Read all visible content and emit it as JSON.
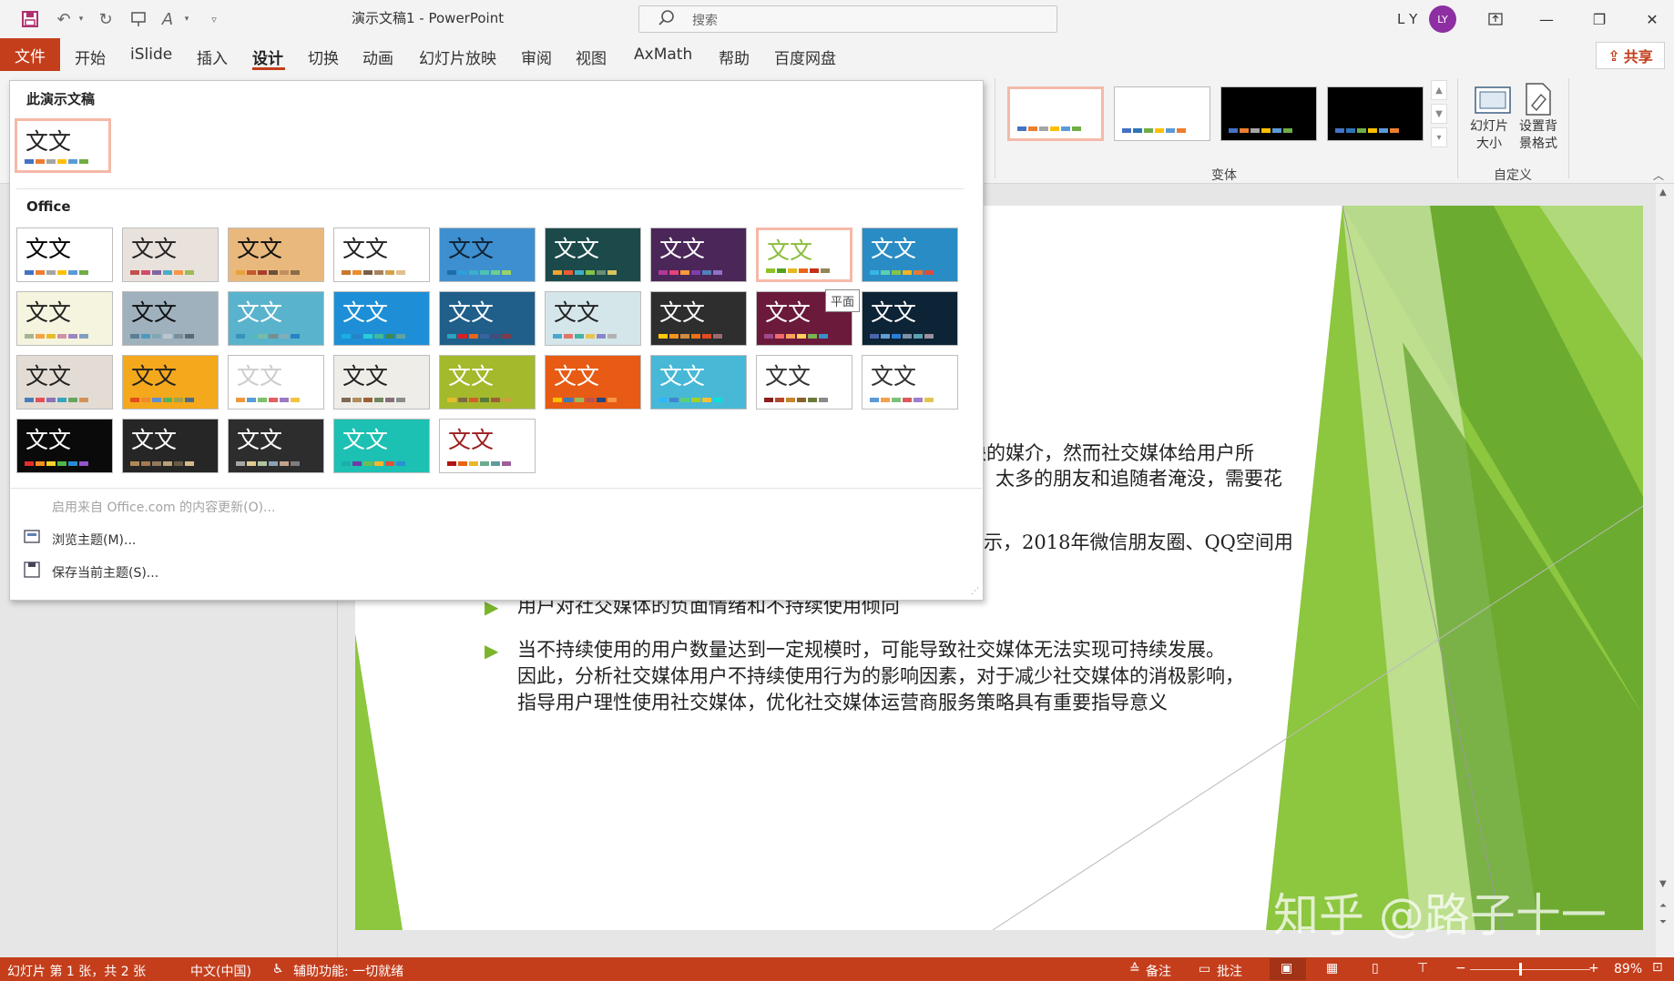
{
  "window": {
    "title": "演示文稿1  -  PowerPoint",
    "search_placeholder": "搜索",
    "user_name": "L Y",
    "user_initials": "LY"
  },
  "ribbon": {
    "tabs": [
      "文件",
      "开始",
      "iSlide",
      "插入",
      "设计",
      "切换",
      "动画",
      "幻灯片放映",
      "审阅",
      "视图",
      "AxMath",
      "帮助",
      "百度网盘"
    ],
    "active_tab": "设计",
    "share_label": "共享",
    "variants_group_label": "变体",
    "customize_group_label": "自定义",
    "slide_size_label": "幻灯片大小",
    "format_bg_label": "设置背景格式",
    "variant_swatches": [
      {
        "bg": "#ffffff",
        "colors": [
          "#4472c4",
          "#ed7d31",
          "#a5a5a5",
          "#ffc000",
          "#5b9bd5",
          "#70ad47"
        ]
      },
      {
        "bg": "#ffffff",
        "colors": [
          "#4472c4",
          "#2e75b6",
          "#70ad47",
          "#ffc000",
          "#5b9bd5",
          "#ed7d31"
        ]
      },
      {
        "bg": "#000000",
        "colors": [
          "#4472c4",
          "#ed7d31",
          "#a5a5a5",
          "#ffc000",
          "#5b9bd5",
          "#70ad47"
        ]
      },
      {
        "bg": "#000000",
        "colors": [
          "#4472c4",
          "#2e75b6",
          "#70ad47",
          "#ffc000",
          "#5b9bd5",
          "#ed7d31"
        ]
      }
    ]
  },
  "themes_dropdown": {
    "this_presentation_label": "此演示文稿",
    "office_label": "Office",
    "theme_sample_text": "文文",
    "tooltip": "平面",
    "menu_enable_updates": "启用来自 Office.com 的内容更新(O)...",
    "menu_browse": "浏览主题(M)...",
    "menu_save": "保存当前主题(S)..."
  },
  "slide": {
    "text_1a": "缺的媒介，然而社交媒体给用户所",
    "text_1b": "太多的朋友和追随者淹没，需要花",
    "text_2": "示，2018年微信朋友圈、QQ空间用",
    "bullet_1": "用户对社交媒体的负面情绪和不持续使用倾向",
    "bullet_2_l1": "当不持续使用的用户数量达到一定规模时，可能导致社交媒体无法实现可持续发展。",
    "bullet_2_l2": "因此，分析社交媒体用户不持续使用行为的影响因素，对于减少社交媒体的消极影响，",
    "bullet_2_l3": "指导用户理性使用社交媒体，优化社交媒体运营商服务策略具有重要指导意义",
    "watermark": "知乎 @路子十一"
  },
  "status": {
    "slide_info": "幻灯片 第 1 张，共 2 张",
    "language": "中文(中国)",
    "accessibility": "辅助功能: 一切就绪",
    "notes": "备注",
    "comments": "批注",
    "zoom": "89%"
  }
}
